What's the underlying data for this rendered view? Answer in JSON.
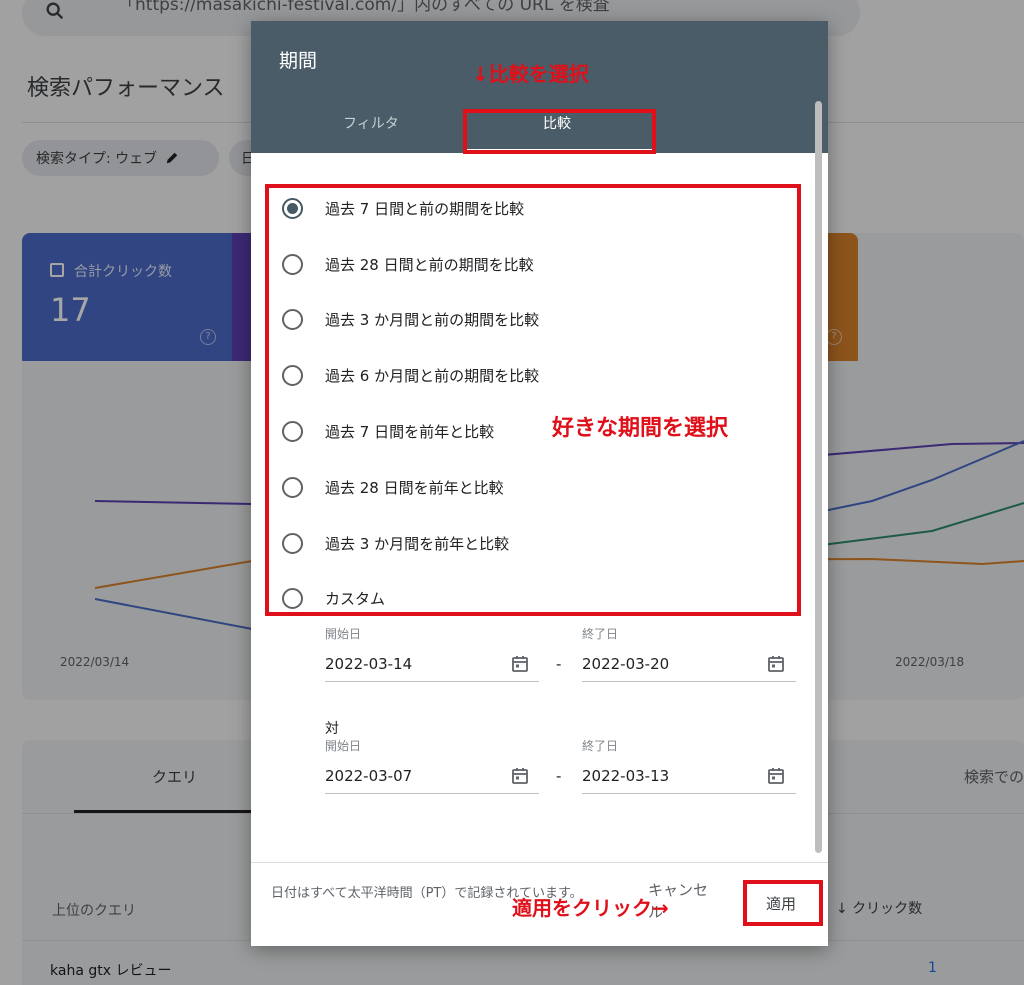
{
  "background": {
    "search_placeholder": "「https://masakichi-festival.com/」内のすべての URL を検査",
    "page_title": "検索パフォーマンス",
    "chip_search_type": "検索タイプ: ウェブ",
    "chip_second": "日",
    "metric_clicks_label": "合計クリック数",
    "metric_clicks_value": "17",
    "axis_left_date": "2022/03/14",
    "axis_right_date": "2022/03/18",
    "tab_query": "クエリ",
    "tab_search_appearance": "検索での",
    "table_header_query": "上位のクエリ",
    "table_header_clicks": "↓ クリック数",
    "rows": [
      {
        "query": "kaha gtx レビュー",
        "clicks": "1"
      }
    ]
  },
  "dialog": {
    "title": "期間",
    "tabs": [
      {
        "label": "フィルタ"
      },
      {
        "label": "比較"
      }
    ],
    "options": [
      {
        "label": "過去 7 日間と前の期間を比較",
        "checked": true
      },
      {
        "label": "過去 28 日間と前の期間を比較",
        "checked": false
      },
      {
        "label": "過去 3 か月間と前の期間を比較",
        "checked": false
      },
      {
        "label": "過去 6 か月間と前の期間を比較",
        "checked": false
      },
      {
        "label": "過去 7 日間を前年と比較",
        "checked": false
      },
      {
        "label": "過去 28 日間を前年と比較",
        "checked": false
      },
      {
        "label": "過去 3 か月間を前年と比較",
        "checked": false
      },
      {
        "label": "カスタム",
        "checked": false
      }
    ],
    "range1": {
      "start_label": "開始日",
      "start": "2022-03-14",
      "end_label": "終了日",
      "end": "2022-03-20"
    },
    "vs_label": "対",
    "range2": {
      "start_label": "開始日",
      "start": "2022-03-07",
      "end_label": "終了日",
      "end": "2022-03-13"
    },
    "dash": "-",
    "footer_note": "日付はすべて太平洋時間（PT）で記録されています。",
    "cancel": "キャンセル",
    "apply": "適用"
  },
  "annotations": {
    "select_compare": "↓比較を選択",
    "select_period": "好きな期間を選択",
    "click_apply": "適用をクリック→"
  },
  "colors": {
    "header": "#4a5c67",
    "annotation_red": "#e0101a",
    "clicks_blue": "#4a6bc8"
  }
}
